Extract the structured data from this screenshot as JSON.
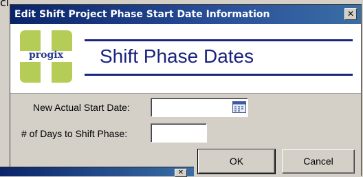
{
  "background_fragment": {
    "text": "cl"
  },
  "dialog": {
    "title": "Edit Shift Project Phase Start Date Information",
    "close_glyph": "✕"
  },
  "header": {
    "logo_text": "progix",
    "title": "Shift Phase Dates"
  },
  "form": {
    "start_date_label": "New Actual Start Date:",
    "start_date_value": "",
    "days_label": "# of Days to Shift Phase:",
    "days_value": ""
  },
  "buttons": {
    "ok_label": "OK",
    "cancel_label": "Cancel"
  },
  "second_window": {
    "close_glyph": "✕"
  },
  "icons": {
    "calendar": "calendar-icon",
    "close": "close-icon",
    "logo": "progix-logo"
  },
  "colors": {
    "titlebar": "#0a246a",
    "header_accent": "#1a237e",
    "logo_green": "#b5cc57",
    "window_bg": "#d4d0c8"
  }
}
